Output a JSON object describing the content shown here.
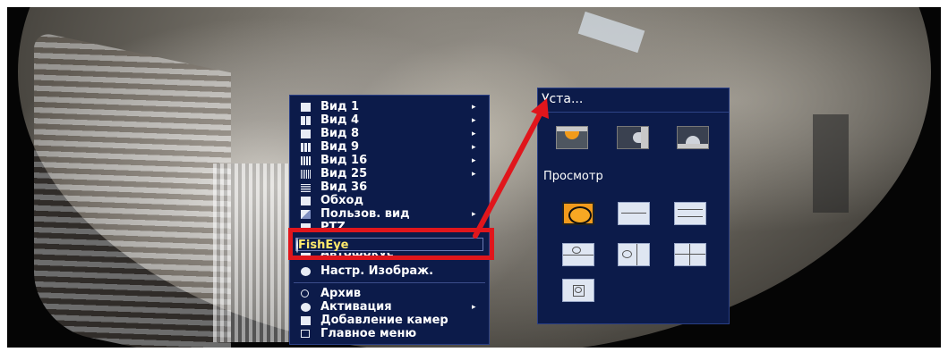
{
  "colors": {
    "menu_bg": "#0c1b4a",
    "selected_text": "#ffe96b",
    "highlight_red": "#e0161c",
    "selected_tile": "#f19a1c"
  },
  "context_menu": {
    "items": [
      {
        "label": "Вид 1",
        "icon": "layout-1-icon",
        "submenu": true
      },
      {
        "label": "Вид 4",
        "icon": "layout-4-icon",
        "submenu": true
      },
      {
        "label": "Вид 8",
        "icon": "layout-8-icon",
        "submenu": true
      },
      {
        "label": "Вид 9",
        "icon": "layout-9-icon",
        "submenu": true
      },
      {
        "label": "Вид 16",
        "icon": "layout-16-icon",
        "submenu": true
      },
      {
        "label": "Вид 25",
        "icon": "layout-25-icon",
        "submenu": true
      },
      {
        "label": "Вид 36",
        "icon": "layout-36-icon",
        "submenu": false
      },
      {
        "label": "Обход",
        "icon": "sequence-icon",
        "submenu": false
      },
      {
        "label": "Пользов. вид",
        "icon": "custom-view-icon",
        "submenu": true
      },
      {
        "label": "PTZ",
        "icon": "ptz-icon",
        "submenu": false
      },
      {
        "label": "FishEye",
        "icon": "fisheye-icon",
        "submenu": false,
        "selected": true
      },
      {
        "label": "Автофокус",
        "icon": "autofocus-icon",
        "submenu": false
      },
      {
        "label": "Настр. Изображ.",
        "icon": "image-settings-icon",
        "submenu": false
      },
      {
        "label": "Архив",
        "icon": "search-icon",
        "submenu": false
      },
      {
        "label": "Активация",
        "icon": "activation-icon",
        "submenu": true
      },
      {
        "label": "Добавление камер",
        "icon": "add-camera-icon",
        "submenu": false
      },
      {
        "label": "Главное меню",
        "icon": "home-icon",
        "submenu": false
      }
    ]
  },
  "fisheye_panel": {
    "title": "Уста...",
    "install_modes": [
      {
        "name": "ceiling-mount-icon",
        "selected": true
      },
      {
        "name": "wall-mount-icon",
        "selected": false
      },
      {
        "name": "ground-mount-icon",
        "selected": false
      }
    ],
    "view_header": "Просмотр",
    "view_modes": [
      {
        "name": "fisheye-original-view-icon",
        "selected": true
      },
      {
        "name": "panorama-view-icon",
        "selected": false
      },
      {
        "name": "dual-panorama-view-icon",
        "selected": false
      },
      {
        "name": "fisheye-plus-3-view-icon",
        "selected": false
      },
      {
        "name": "fisheye-plus-4-view-icon",
        "selected": false
      },
      {
        "name": "panorama-plus-3-view-icon",
        "selected": false
      },
      {
        "name": "fisheye-plus-8-view-icon",
        "selected": false
      }
    ]
  }
}
